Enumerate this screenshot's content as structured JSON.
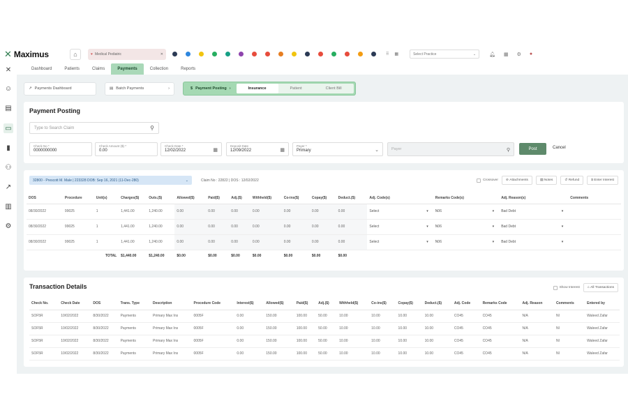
{
  "app": {
    "name": "Maximus"
  },
  "topbar": {
    "patient_tab": "Medical Pediatric",
    "dot_colors": [
      "#2b3a55",
      "#2e86de",
      "#f1c40f",
      "#27ae60",
      "#16a085",
      "#8e44ad",
      "#e74c3c",
      "#e74c3c",
      "#e67e22",
      "#f1c40f",
      "#2b3a55",
      "#e74c3c",
      "#27ae60",
      "#e74c3c",
      "#f39c12",
      "#2b3a55"
    ],
    "more_label": "⠿",
    "grid_label": "▦",
    "practice_placeholder": "Select Practice"
  },
  "nav": {
    "tabs": [
      "Dashboard",
      "Patients",
      "Claims",
      "Payments",
      "Collection",
      "Reports"
    ],
    "active": "Payments"
  },
  "subbar": {
    "payments_dashboard": "Payments Dashboard",
    "batch_payments": "Batch Payments",
    "payment_posting": "Payment Posting",
    "options": [
      "Insurance",
      "Patient",
      "Client Bill"
    ],
    "active_option": "Insurance"
  },
  "posting": {
    "title": "Payment Posting",
    "search_placeholder": "Type to Search Claim",
    "fields": [
      {
        "label": "Check No *",
        "value": "0000000000"
      },
      {
        "label": "Check Amount ($) *",
        "value": "0.00"
      },
      {
        "label": "Check Date *",
        "value": "12/02/2022"
      },
      {
        "label": "Deposit Date",
        "value": "12/09/2022"
      },
      {
        "label": "Payer *",
        "value": "Primary"
      }
    ],
    "payee_placeholder": "Payer",
    "post_label": "Post",
    "cancel_label": "Cancel"
  },
  "claim": {
    "chip": "32800 - Prescott M. Male | 223328 DOB: Sep 16, 2021 (11-Dec-280)",
    "info": "Claim No : 22822 | DOS : 12/02/2022",
    "crossover": "Crossover",
    "attachments": "Attachments",
    "notes": "Notes",
    "refund": "Refund",
    "interest": "Enter Interest",
    "columns": [
      "DOS",
      "Procedure",
      "Unit(s)",
      "Charges($)",
      "Outs.($)",
      "Allowed($)",
      "Paid($)",
      "Adj.($)",
      "Withheld($)",
      "Co-ins($)",
      "Copay($)",
      "Deduct.($)",
      "Adj. Code(s)",
      "Remarks Code(s)",
      "Adj. Reason(s)",
      "Comments"
    ],
    "rows": [
      [
        "08/30/2022",
        "99025",
        "1",
        "1,441.00",
        "1,240.00",
        "0.00",
        "0.00",
        "0.00",
        "0.00",
        "0.00",
        "0.00",
        "0.00",
        "Select",
        "N06",
        "Bad Debt"
      ],
      [
        "08/30/2022",
        "99025",
        "1",
        "1,441.00",
        "1,240.00",
        "0.00",
        "0.00",
        "0.00",
        "0.00",
        "0.00",
        "0.00",
        "0.00",
        "Select",
        "N06",
        "Bad Debt"
      ],
      [
        "08/30/2022",
        "99025",
        "1",
        "1,441.00",
        "1,240.00",
        "0.00",
        "0.00",
        "0.00",
        "0.00",
        "0.00",
        "0.00",
        "0.00",
        "Select",
        "N06",
        "Bad Debt"
      ]
    ],
    "totals": {
      "label": "TOTAL",
      "values": [
        "$1,440.00",
        "$1,240.00",
        "$0.00",
        "$0.00",
        "$0.00",
        "$0.00",
        "$0.00",
        "$0.00",
        "$0.00"
      ]
    }
  },
  "transactions": {
    "title": "Transaction Details",
    "show_interest": "Show Interest",
    "all_transactions": "All Transactions",
    "columns": [
      "Check No.",
      "Check Date",
      "DOS",
      "Trans. Type",
      "Description",
      "Procedure Code",
      "Interest($)",
      "Allowed($)",
      "Paid($)",
      "Adj.($)",
      "Withheld($)",
      "Co-ins($)",
      "Copay($)",
      "Deduct.($)",
      "Adj. Code",
      "Remarks Code",
      "Adj. Reason",
      "Comments",
      "Entered by"
    ],
    "rows": [
      [
        "SOF5R",
        "10/02/2022",
        "8/30/2022",
        "Payments",
        "Primary Max Ins",
        "0005F",
        "0.00",
        "150.00",
        "100.00",
        "50.00",
        "10.00",
        "10.00",
        "10.00",
        "10.00",
        "CO45",
        "CO45",
        "N/A",
        "NI",
        "Waleed Zafar"
      ],
      [
        "SOF5R",
        "10/02/2022",
        "8/30/2022",
        "Payments",
        "Primary Max Ins",
        "0005F",
        "0.00",
        "150.00",
        "100.00",
        "50.00",
        "10.00",
        "10.00",
        "10.00",
        "10.00",
        "CO45",
        "CO45",
        "N/A",
        "NI",
        "Waleed Zafar"
      ],
      [
        "SOF5R",
        "10/02/2022",
        "8/30/2022",
        "Payments",
        "Primary Max Ins",
        "0005F",
        "0.00",
        "150.00",
        "100.00",
        "50.00",
        "10.00",
        "10.00",
        "10.00",
        "10.00",
        "CO45",
        "CO45",
        "N/A",
        "NI",
        "Waleed Zafar"
      ],
      [
        "SOF5R",
        "10/02/2022",
        "8/30/2022",
        "Payments",
        "Primary Max Ins",
        "0005F",
        "0.00",
        "150.00",
        "100.00",
        "50.00",
        "10.00",
        "10.00",
        "10.00",
        "10.00",
        "CO45",
        "CO45",
        "N/A",
        "NI",
        "Waleed Zafar"
      ]
    ]
  }
}
